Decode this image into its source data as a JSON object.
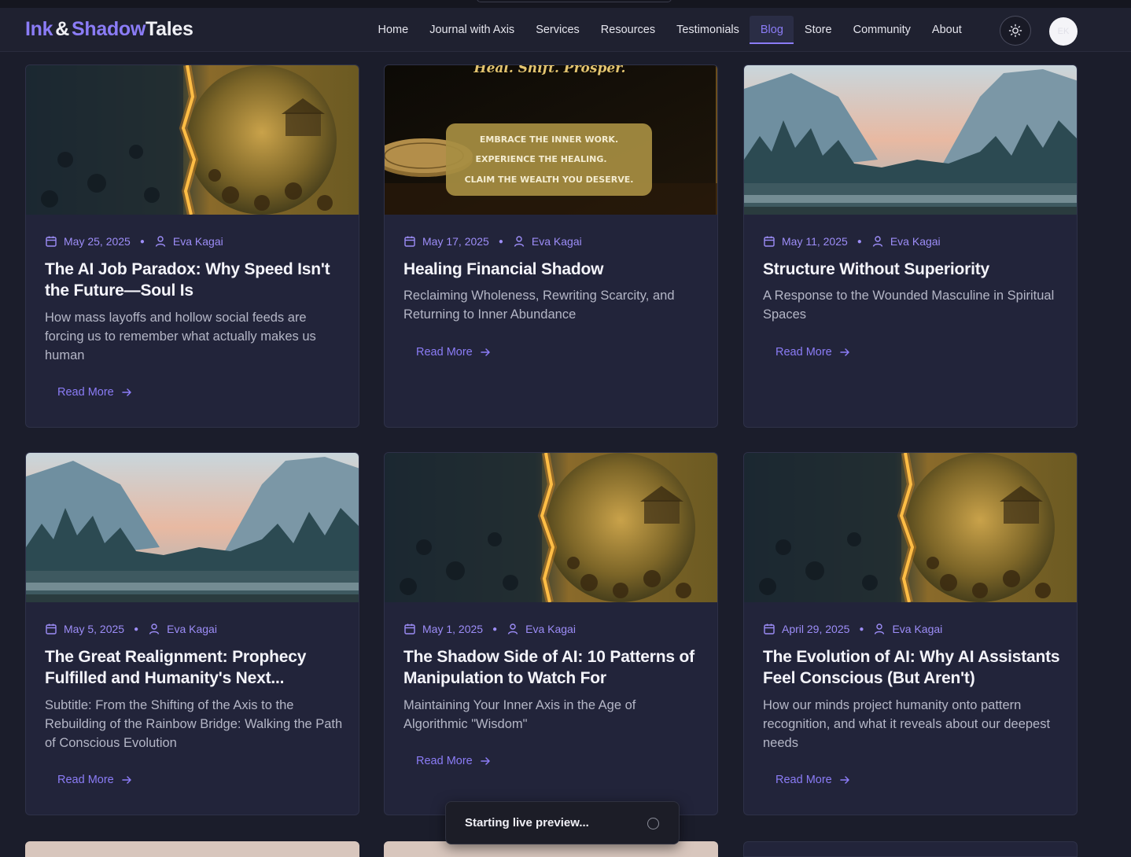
{
  "brand": {
    "part1": "Ink",
    "part2": "&",
    "part3": "Shadow",
    "part4": "Tales"
  },
  "nav": [
    {
      "label": "Home",
      "active": false
    },
    {
      "label": "Journal with Axis",
      "active": false
    },
    {
      "label": "Services",
      "active": false
    },
    {
      "label": "Resources",
      "active": false
    },
    {
      "label": "Testimonials",
      "active": false
    },
    {
      "label": "Blog",
      "active": true
    },
    {
      "label": "Store",
      "active": false
    },
    {
      "label": "Community",
      "active": false
    },
    {
      "label": "About",
      "active": false
    }
  ],
  "avatar": {
    "initials": "EK"
  },
  "read_more_label": "Read More",
  "posts": [
    {
      "date": "May 25, 2025",
      "author": "Eva Kagai",
      "title": "The AI Job Paradox: Why Speed Isn't the Future—Soul Is",
      "subtitle": "How mass layoffs and hollow social feeds are forcing us to remember what actually makes us human",
      "image": "earth-split-illustration"
    },
    {
      "date": "May 17, 2025",
      "author": "Eva Kagai",
      "title": "Healing Financial Shadow",
      "subtitle": "Reclaiming Wholeness, Rewriting Scarcity, and Returning to Inner Abundance",
      "image": "golden-coin-banner",
      "banner": {
        "heading": "Heal. Shift. Prosper.",
        "lines": [
          "EMBRACE THE INNER WORK.",
          "EXPERIENCE THE HEALING.",
          "CLAIM THE WEALTH YOU DESERVE."
        ]
      }
    },
    {
      "date": "May 11, 2025",
      "author": "Eva Kagai",
      "title": "Structure Without Superiority",
      "subtitle": "A Response to the Wounded Masculine in Spiritual Spaces",
      "image": "valley-landscape"
    },
    {
      "date": "May 5, 2025",
      "author": "Eva Kagai",
      "title": "The Great Realignment: Prophecy Fulfilled and Humanity's Next...",
      "subtitle": "Subtitle: From the Shifting of the Axis to the Rebuilding of the Rainbow Bridge: Walking the Path of Conscious Evolution",
      "image": "valley-landscape"
    },
    {
      "date": "May 1, 2025",
      "author": "Eva Kagai",
      "title": "The Shadow Side of AI: 10 Patterns of Manipulation to Watch For",
      "subtitle": "Maintaining Your Inner Axis in the Age of Algorithmic \"Wisdom\"",
      "image": "earth-split-illustration"
    },
    {
      "date": "April 29, 2025",
      "author": "Eva Kagai",
      "title": "The Evolution of AI: Why AI Assistants Feel Conscious (But Aren't)",
      "subtitle": "How our minds project humanity onto pattern recognition, and what it reveals about our deepest needs",
      "image": "earth-split-illustration"
    }
  ],
  "toast": {
    "message": "Starting live preview..."
  },
  "colors": {
    "accent": "#8b7cf6",
    "background": "#1b1d2b",
    "card": "#22243a"
  }
}
